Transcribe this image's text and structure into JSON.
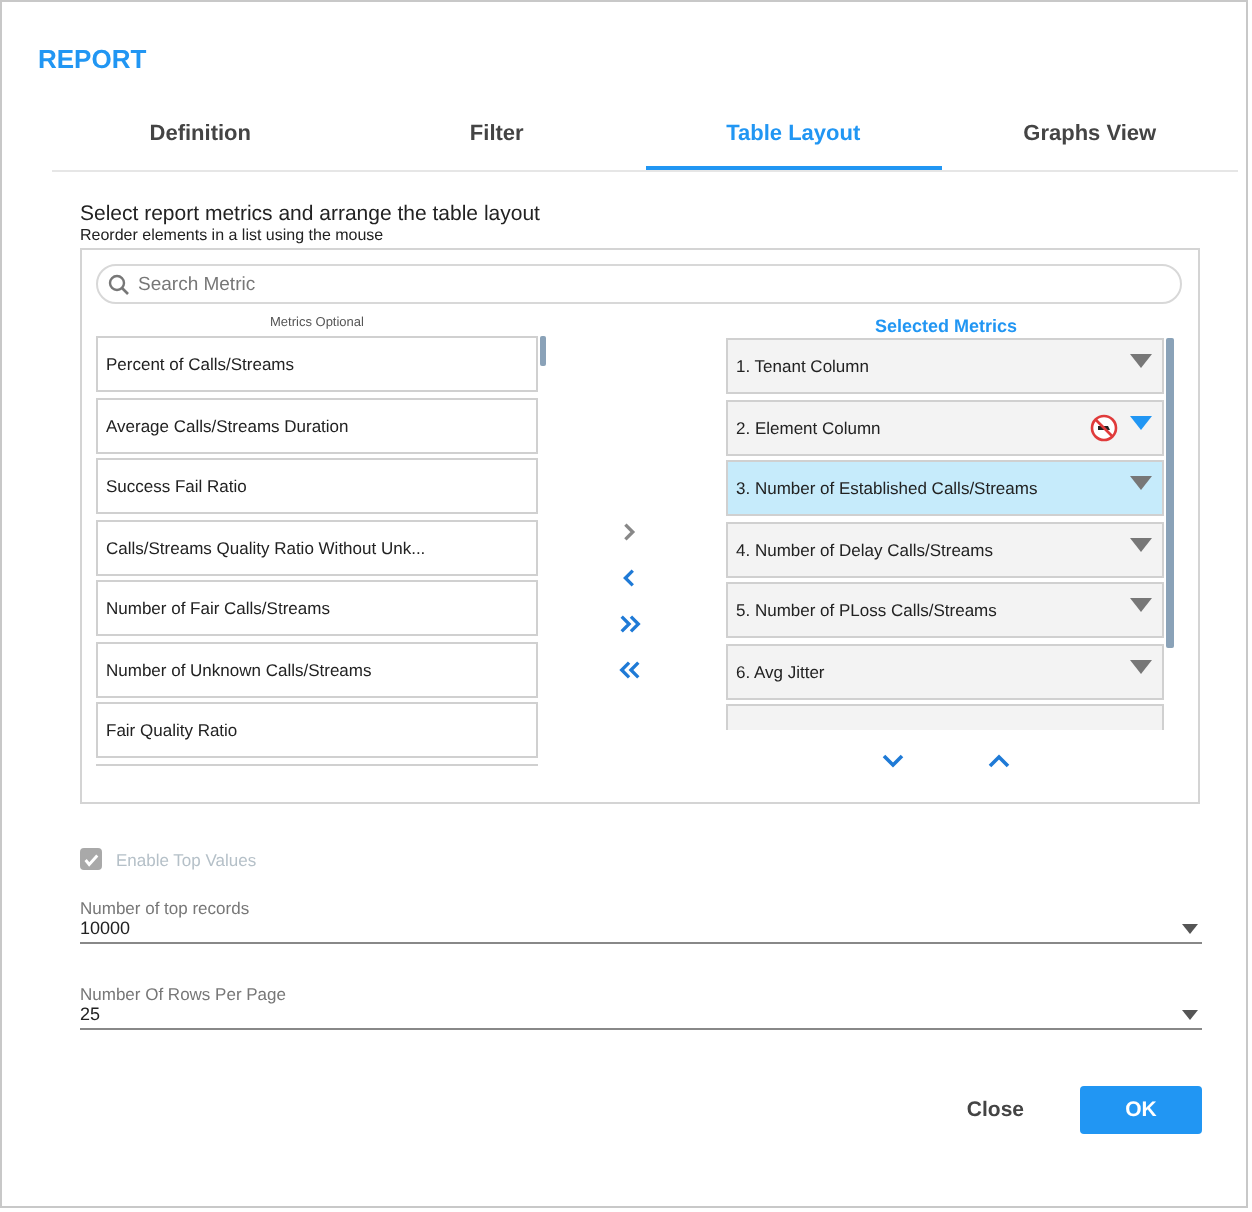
{
  "dialog": {
    "title": "REPORT"
  },
  "tabs": [
    {
      "label": "Definition",
      "selected": false
    },
    {
      "label": "Filter",
      "selected": false
    },
    {
      "label": "Table Layout",
      "selected": true
    },
    {
      "label": "Graphs View",
      "selected": false
    }
  ],
  "intro": {
    "heading": "Select report metrics and arrange the table layout",
    "hint": "Reorder elements in a list using the mouse"
  },
  "search": {
    "placeholder": "Search Metric"
  },
  "optional_metrics": {
    "title": "Metrics Optional",
    "items": [
      "Percent of Calls/Streams",
      "Average Calls/Streams Duration",
      "Success Fail Ratio",
      "Calls/Streams Quality Ratio Without Unk...",
      "Number of Fair Calls/Streams",
      "Number of Unknown Calls/Streams",
      "Fair Quality Ratio"
    ]
  },
  "transfer_buttons": [
    {
      "kind": "right",
      "disabled": true
    },
    {
      "kind": "left",
      "disabled": false
    },
    {
      "kind": "all-right",
      "disabled": false
    },
    {
      "kind": "all-left",
      "disabled": false
    }
  ],
  "selected_metrics": {
    "title": "Selected Metrics",
    "items": [
      {
        "label": "1. Tenant Column",
        "selected": false,
        "hovered": false
      },
      {
        "label": "2. Element Column",
        "selected": false,
        "hovered": true
      },
      {
        "label": "3. Number of Established Calls/Streams",
        "selected": true,
        "hovered": false
      },
      {
        "label": "4. Number of Delay Calls/Streams",
        "selected": false,
        "hovered": false
      },
      {
        "label": "5. Number of PLoss Calls/Streams",
        "selected": false,
        "hovered": false
      },
      {
        "label": "6. Avg Jitter",
        "selected": false,
        "hovered": false
      }
    ]
  },
  "enable_top_values": {
    "label": "Enable Top Values",
    "checked": true,
    "disabled": true
  },
  "fields": [
    {
      "label": "Number of top records",
      "value": "10000"
    },
    {
      "label": "Number Of Rows Per Page",
      "value": "25"
    }
  ],
  "buttons": [
    {
      "kind": "text",
      "label": "Close"
    },
    {
      "kind": "primary",
      "label": "OK"
    }
  ]
}
